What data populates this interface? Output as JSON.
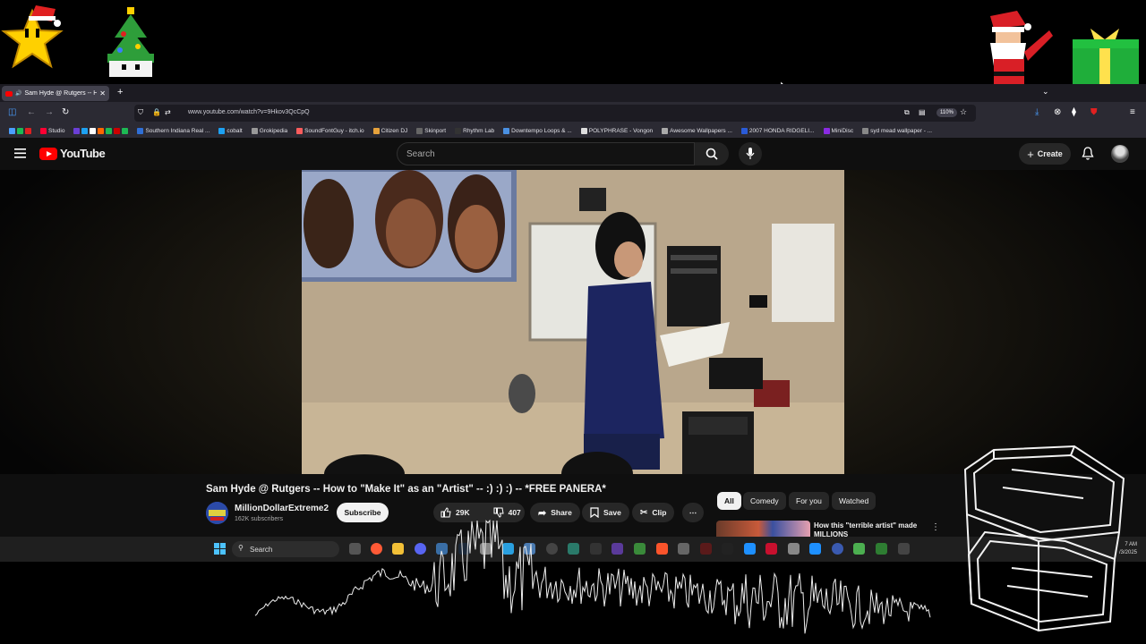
{
  "browser": {
    "tab_title": "Sam Hyde @ Rutgers -- Ho",
    "new_tab": "+",
    "url": "www.youtube.com/watch?v=9Hkov3QcCpQ",
    "zoom": "110%",
    "bookmarks": [
      {
        "label": "Studio",
        "color": "#ff0033"
      },
      {
        "label": "Southern Indiana Real ...",
        "color": "#2f6fd6"
      },
      {
        "label": "cobalt",
        "color": "#444"
      },
      {
        "label": "Grokipedia",
        "color": "#999"
      },
      {
        "label": "SoundFontGuy - itch.io",
        "color": "#fa5c5c"
      },
      {
        "label": "Citizen DJ",
        "color": "#e6a23c"
      },
      {
        "label": "Skinport",
        "color": "#666"
      },
      {
        "label": "Rhythm Lab",
        "color": "#333"
      },
      {
        "label": "Downtempo Loops & ...",
        "color": "#4a90e2"
      },
      {
        "label": "POLYPHRASE - Vongon",
        "color": "#ddd"
      },
      {
        "label": "Awesome Wallpapers ...",
        "color": "#aaa"
      },
      {
        "label": "2007 HONDA RIDGELI...",
        "color": "#2a5bd7"
      },
      {
        "label": "MiniDisc",
        "color": "#8a2be2"
      },
      {
        "label": "syd mead wallpaper - ...",
        "color": "#888"
      }
    ]
  },
  "youtube": {
    "logo_text": "YouTube",
    "search_placeholder": "Search",
    "create_label": "Create",
    "video_title": "Sam Hyde @ Rutgers -- How to \"Make It\" as an \"Artist\" -- :) :) :) -- *FREE PANERA*",
    "channel_name": "MillionDollarExtreme2",
    "channel_subs": "162K subscribers",
    "subscribe_label": "Subscribe",
    "likes": "29K",
    "dislikes": "407",
    "share_label": "Share",
    "save_label": "Save",
    "clip_label": "Clip",
    "chips": [
      "All",
      "Comedy",
      "For you",
      "Watched"
    ],
    "rec_title": "How this \"terrible artist\" made MILLIONS"
  },
  "taskbar": {
    "search_label": "Search",
    "time": "7 AM",
    "date": "/3/2025"
  },
  "colors": {
    "youtube_red": "#ff0000",
    "background": "#0f0f0f"
  }
}
